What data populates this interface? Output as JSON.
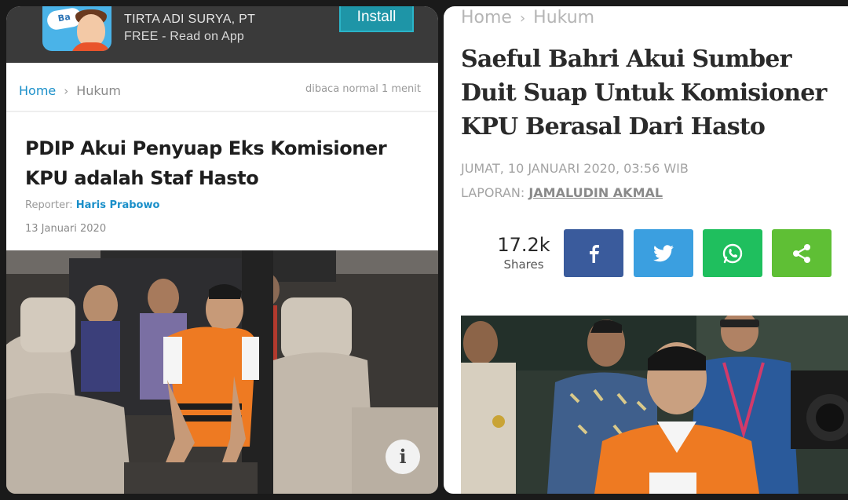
{
  "left": {
    "app_banner": {
      "icon_text": "Ba",
      "company": "TIRTA ADI SURYA, PT",
      "subtitle": "FREE - Read on App",
      "install_label": "Install"
    },
    "breadcrumb": {
      "home": "Home",
      "separator": "›",
      "category": "Hukum"
    },
    "read_time": "dibaca normal 1 menit",
    "title": "PDIP Akui Penyuap Eks Komisioner KPU adalah Staf Hasto",
    "reporter_label": "Reporter:",
    "reporter_name": "Haris Prabowo",
    "date": "13 Januari 2020",
    "info_icon": "i"
  },
  "right": {
    "breadcrumb": {
      "home": "Home",
      "separator": "›",
      "category": "Hukum"
    },
    "title": "Saeful Bahri Akui Sumber Duit Suap Untuk Komisioner KPU Berasal Dari Hasto",
    "date": "JUMAT, 10 JANUARI 2020, 03:56 WIB",
    "reporter_label": "LAPORAN:",
    "reporter_name": "JAMALUDIN AKMAL",
    "shares_count": "17.2k",
    "shares_label": "Shares",
    "share_buttons": [
      {
        "icon": "facebook-icon",
        "color": "#3a5b9c"
      },
      {
        "icon": "twitter-icon",
        "color": "#3b9fe0"
      },
      {
        "icon": "whatsapp-icon",
        "color": "#1fbf5e"
      },
      {
        "icon": "share-icon",
        "color": "#5fbf35"
      }
    ]
  },
  "colors": {
    "link_blue": "#1a8fc9",
    "vest_orange": "#ee7a22",
    "banner_dark": "#3a3a3a",
    "install_teal": "#1e95a7"
  }
}
